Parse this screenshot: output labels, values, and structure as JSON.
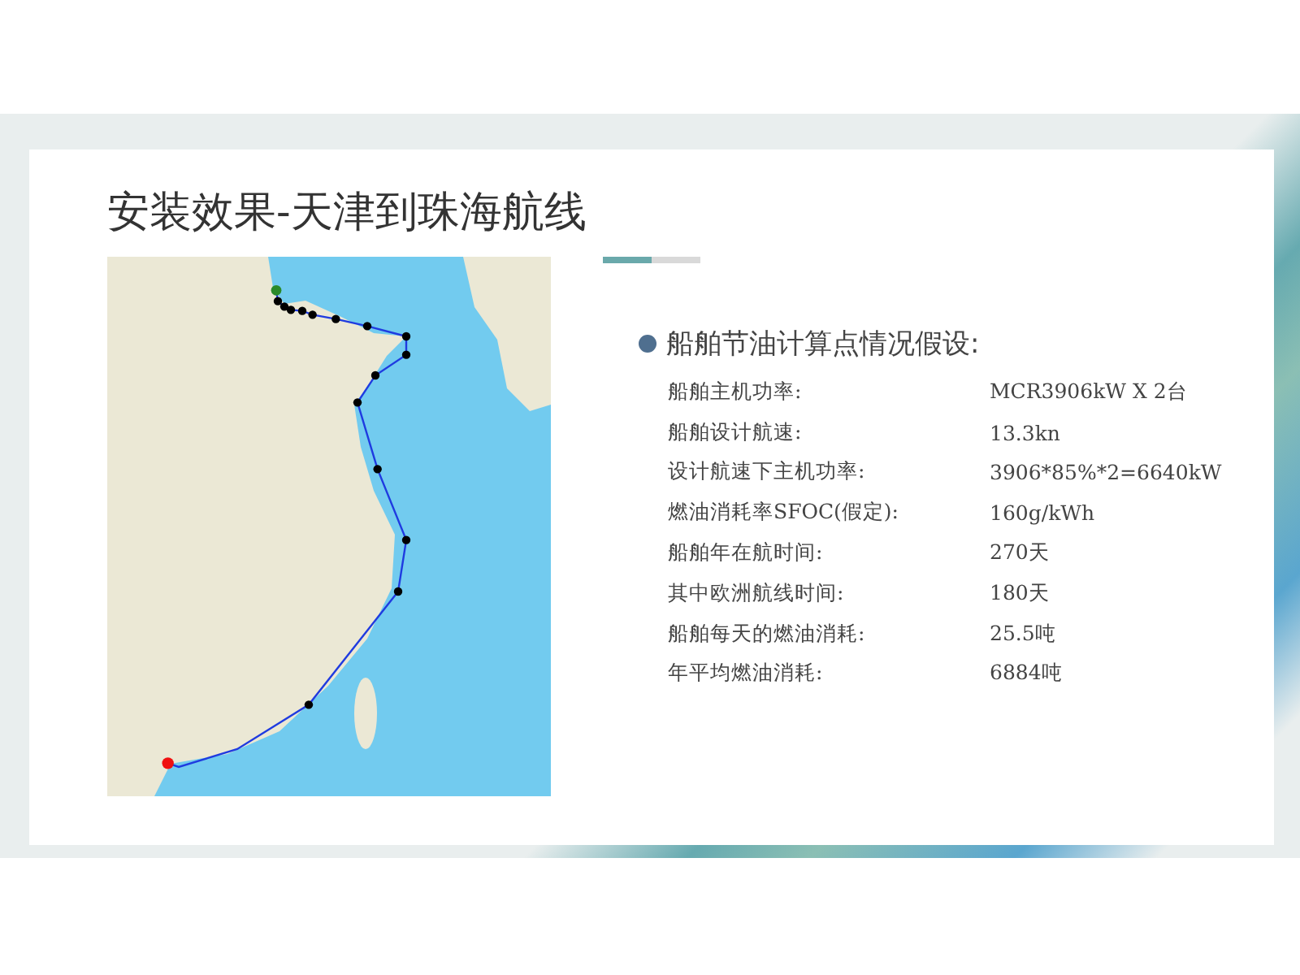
{
  "slide": {
    "title": "安装效果-天津到珠海航线",
    "heading": "船舶节油计算点情况假设:",
    "rows": [
      {
        "label": "船舶主机功率:",
        "value": "MCR3906kW X 2台"
      },
      {
        "label": "船舶设计航速:",
        "value": "13.3kn"
      },
      {
        "label": "设计航速下主机功率:",
        "value": "3906*85%*2=6640kW"
      },
      {
        "label": "燃油消耗率SFOC(假定):",
        "value": "160g/kWh"
      },
      {
        "label": "船舶年在航时间:",
        "value": "270天"
      },
      {
        "label": "其中欧洲航线时间:",
        "value": "180天"
      },
      {
        "label": "船舶每天的燃油消耗:",
        "value": "25.5吨"
      },
      {
        "label": "年平均燃油消耗:",
        "value": "6884吨"
      }
    ]
  }
}
